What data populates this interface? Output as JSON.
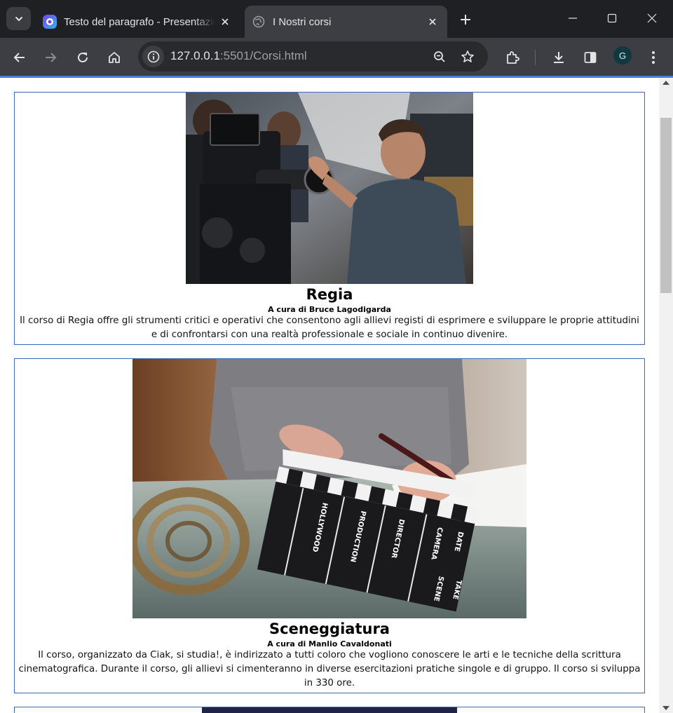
{
  "browser": {
    "tabs": [
      {
        "title": "Testo del paragrafo - Presentazione",
        "active": false
      },
      {
        "title": "I Nostri corsi",
        "active": true
      }
    ],
    "address": {
      "host": "127.0.0.1",
      "rest": ":5501/Corsi.html"
    },
    "profile_initial": "G",
    "accent_color": "#4d7bd6"
  },
  "courses": [
    {
      "title": "Regia",
      "author": "A cura di Bruce Lagodigarda",
      "description": "Il corso di Regia offre gli strumenti critici e operativi che consentono agli allievi registi di esprimere e sviluppare le proprie attitudini e di confrontarsi con una realtà professionale e sociale in continuo divenire."
    },
    {
      "title": "Sceneggiatura",
      "author": "A cura di Manlio Cavaldonati",
      "description": "Il corso, organizzato da Ciak, si studia!, è indirizzato a tutti coloro che vogliono conoscere le arti e le tecniche della scrittura cinematografica. Durante il corso, gli allievi si cimenteranno in diverse esercitazioni pratiche singole e di gruppo. Il corso si sviluppa in 330 ore."
    }
  ],
  "clapper_text": [
    "HOLLYWOOD",
    "PRODUCTION",
    "DIRECTOR",
    "CAMERA",
    "DATE",
    "SCENE",
    "TAKE"
  ],
  "border_color": "#3d6ab8"
}
